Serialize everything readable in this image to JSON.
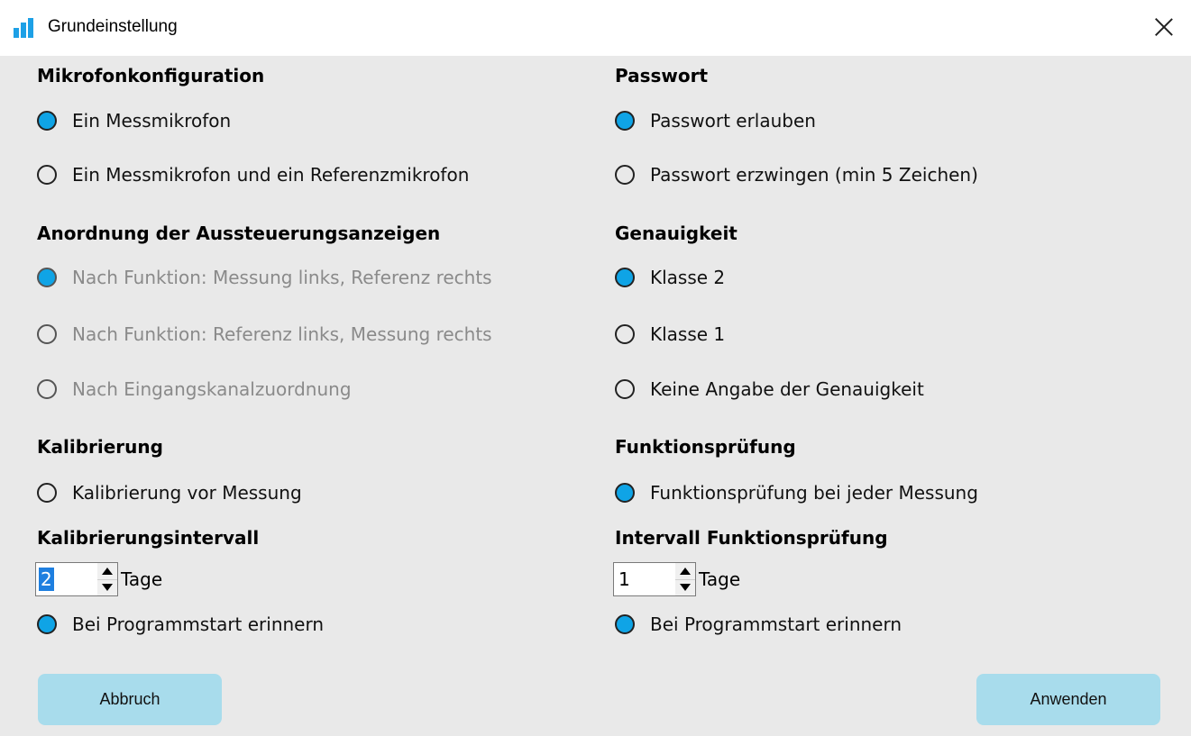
{
  "window": {
    "title": "Grundeinstellung",
    "icon": "bar-chart-icon",
    "close_icon": "close-icon"
  },
  "left": {
    "mic_heading": "Mikrofonkonfiguration",
    "mic_options": [
      {
        "label": "Ein Messmikrofon",
        "checked": true
      },
      {
        "label": "Ein Messmikrofon und ein Referenzmikrofon",
        "checked": false
      }
    ],
    "meter_heading": "Anordnung der Aussteuerungsanzeigen",
    "meter_options": [
      {
        "label": "Nach Funktion: Messung links, Referenz rechts",
        "checked": true,
        "disabled": true
      },
      {
        "label": "Nach Funktion: Referenz links, Messung rechts",
        "checked": false,
        "disabled": true
      },
      {
        "label": "Nach Eingangskanalzuordnung",
        "checked": false,
        "disabled": true
      }
    ],
    "calib_heading": "Kalibrierung",
    "calib_option": {
      "label": "Kalibrierung vor Messung",
      "checked": false
    },
    "calib_interval_heading": "Kalibrierungsintervall",
    "calib_interval_value": "2",
    "calib_interval_unit": "Tage",
    "calib_remind": {
      "label": "Bei Programmstart erinnern",
      "checked": true
    }
  },
  "right": {
    "pw_heading": "Passwort",
    "pw_options": [
      {
        "label": "Passwort erlauben",
        "checked": true
      },
      {
        "label": "Passwort erzwingen (min 5 Zeichen)",
        "checked": false
      }
    ],
    "acc_heading": "Genauigkeit",
    "acc_options": [
      {
        "label": "Klasse 2",
        "checked": true
      },
      {
        "label": "Klasse 1",
        "checked": false
      },
      {
        "label": "Keine Angabe der Genauigkeit",
        "checked": false
      }
    ],
    "func_heading": "Funktionsprüfung",
    "func_option": {
      "label": "Funktionsprüfung bei jeder Messung",
      "checked": true
    },
    "func_interval_heading": "Intervall Funktionsprüfung",
    "func_interval_value": "1",
    "func_interval_unit": "Tage",
    "func_remind": {
      "label": "Bei Programmstart erinnern",
      "checked": true
    }
  },
  "buttons": {
    "cancel": "Abbruch",
    "apply": "Anwenden"
  },
  "colors": {
    "accent": "#0fa4e6",
    "button_bg": "#a8dcec",
    "dialog_bg": "#e9e9e9"
  }
}
